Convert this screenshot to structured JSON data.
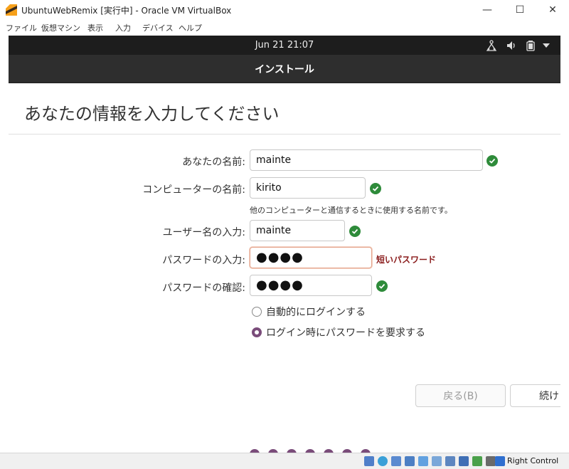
{
  "window": {
    "title": "UbuntuWebRemix [実行中] - Oracle VM VirtualBox",
    "minimize": "—",
    "maximize": "☐",
    "close": "✕"
  },
  "menu": [
    "ファイル",
    "仮想マシン",
    "表示",
    "入力",
    "デバイス",
    "ヘルプ"
  ],
  "topbar": {
    "clock": "Jun 21  21:07"
  },
  "installer": {
    "header": "インストール",
    "page_title": "あなたの情報を入力してください",
    "fields": {
      "name": {
        "label": "あなたの名前:",
        "value": "mainte"
      },
      "computer": {
        "label": "コンピューターの名前:",
        "value": "kirito",
        "hint": "他のコンピューターと通信するときに使用する名前です。"
      },
      "username": {
        "label": "ユーザー名の入力:",
        "value": "mainte"
      },
      "password": {
        "label": "パスワードの入力:",
        "value": "●●●●",
        "warning": "短いパスワード"
      },
      "confirm": {
        "label": "パスワードの確認:",
        "value": "●●●●"
      }
    },
    "options": {
      "auto_login": "自動的にログインする",
      "require_password": "ログイン時にパスワードを要求する",
      "selected": "require_password"
    },
    "buttons": {
      "back": "戻る(B)",
      "continue": "続け"
    },
    "progress_dots": 7
  },
  "statusbar": {
    "host_key": "Right Control"
  },
  "colors": {
    "accent": "#7a4c7a",
    "ok": "#2e8b3a",
    "warning": "#8a1b1b"
  }
}
